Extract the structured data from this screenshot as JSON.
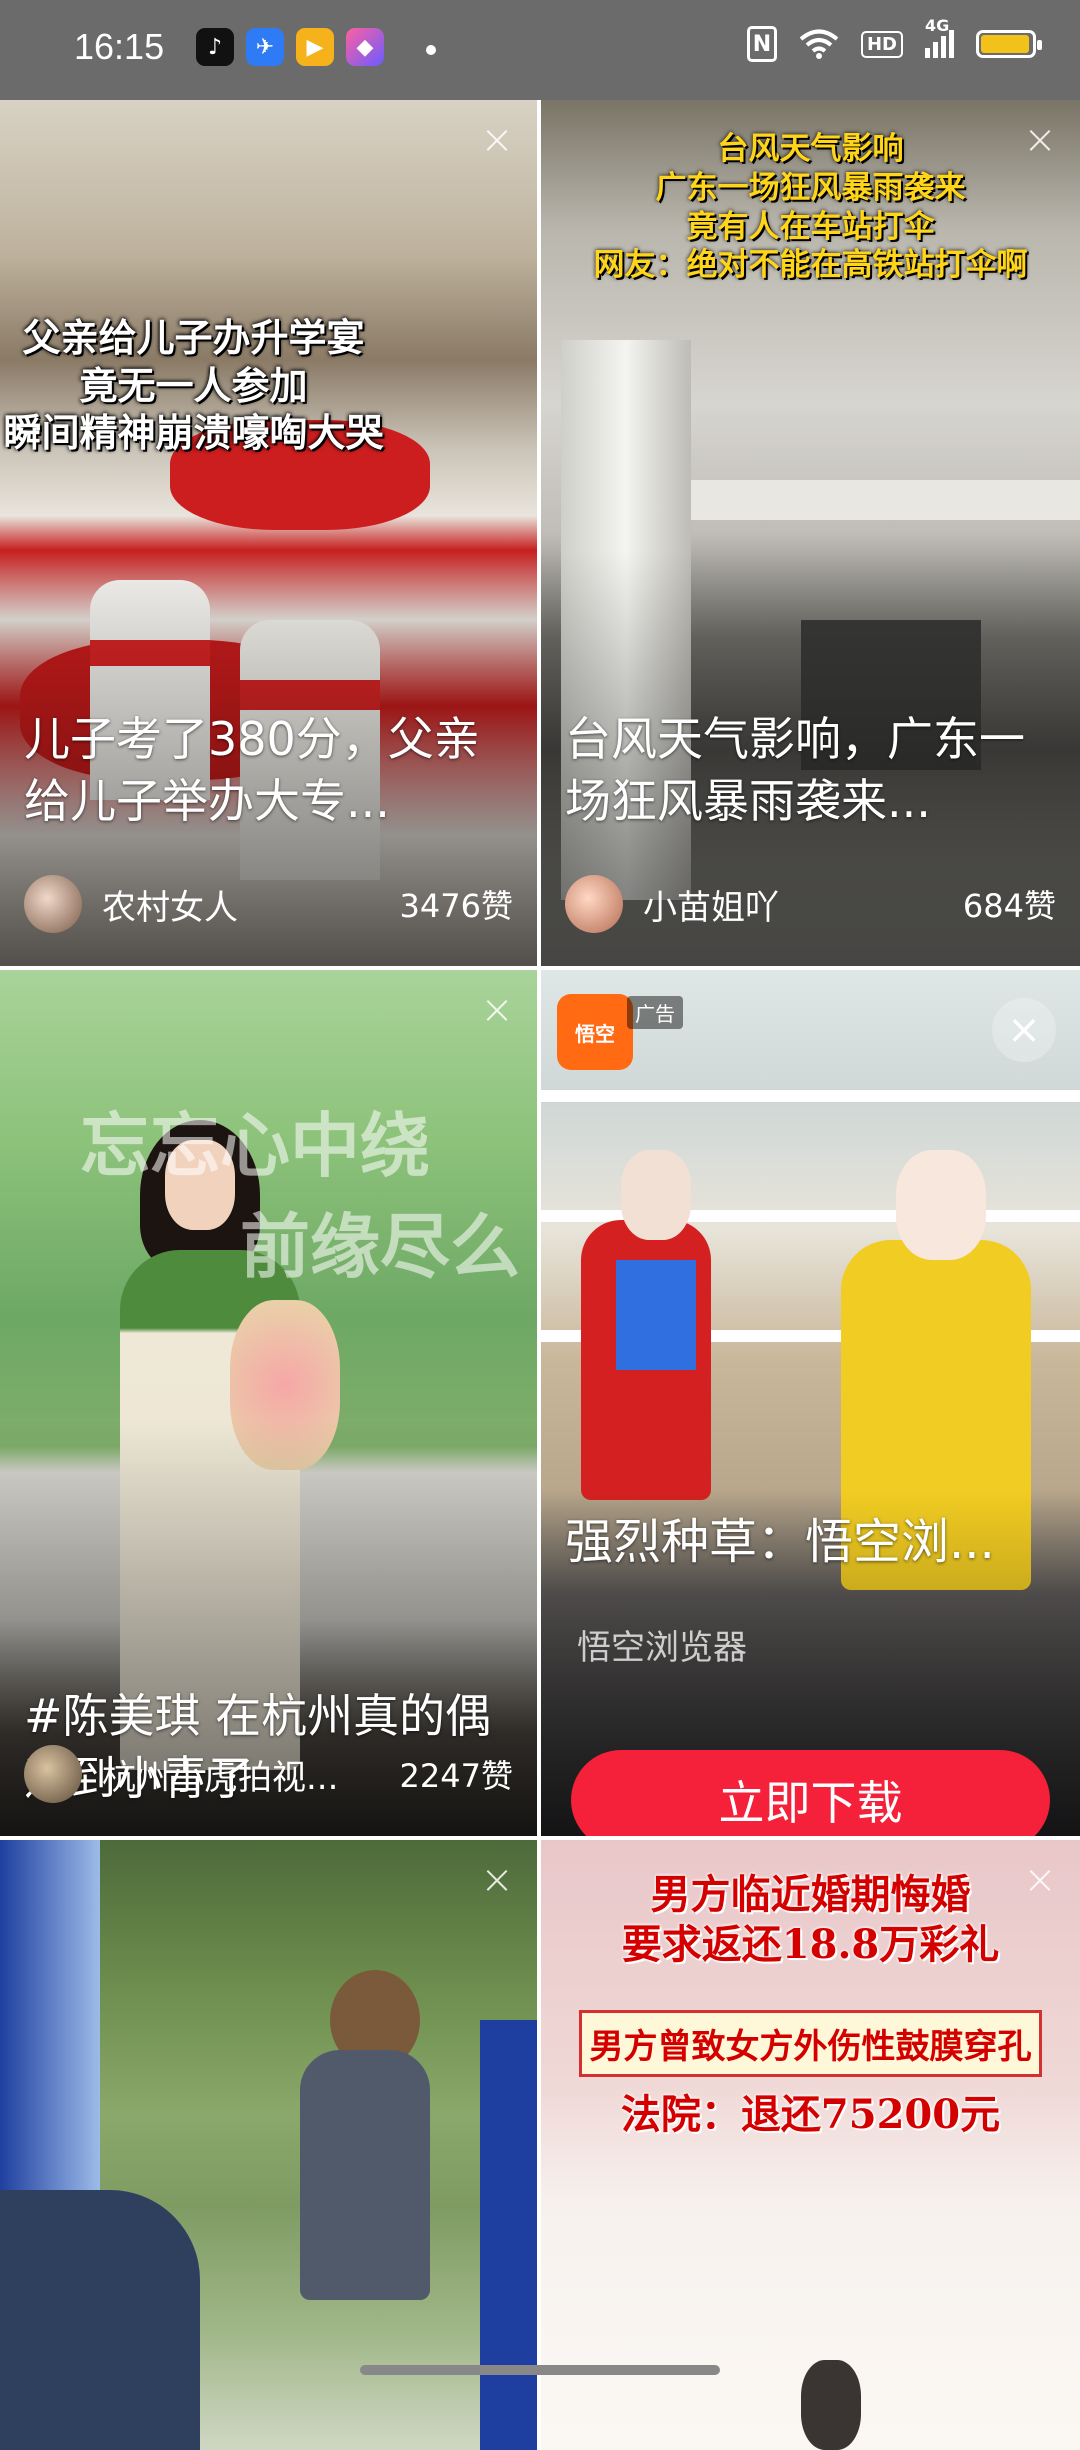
{
  "status_bar": {
    "time": "16:15",
    "apps": [
      "tiktok",
      "dingtalk",
      "video",
      "shortcut"
    ],
    "nfc": "N",
    "hd": "HD",
    "network": "4G",
    "battery_level": 0.95,
    "battery_color": "#f3c21a"
  },
  "feed": [
    {
      "overlay_lines": [
        "父亲给儿子办升学宴",
        "竟无一人参加",
        "瞬间精神崩溃嚎啕大哭"
      ],
      "title": "儿子考了380分，父亲给儿子举办大专...",
      "author": "农村女人",
      "likes": "3476赞"
    },
    {
      "overlay_lines": [
        "台风天气影响",
        "广东一场狂风暴雨袭来",
        "竟有人在车站打伞",
        "网友：绝对不能在高铁站打伞啊"
      ],
      "title": "台风天气影响，广东一场狂风暴雨袭来...",
      "author": "小苗姐吖",
      "likes": "684赞"
    },
    {
      "backdrop_text": [
        "忘忘心中绕",
        "前缘尽么"
      ],
      "title": "#陈美琪 在杭州真的偶遇到小青了",
      "author": "杭州小虎拍视...",
      "likes": "2247赞"
    },
    {
      "ad_tag": "广告",
      "title": "强烈种草：悟空浏...",
      "advertiser": "悟空浏览器",
      "cta": "立即下载"
    },
    {},
    {
      "sign_lines": [
        "男方临近婚期悔婚",
        "要求返还18.8万彩礼",
        "男方曾致女方外伤性鼓膜穿孔",
        "法院：退还75200元"
      ]
    }
  ]
}
